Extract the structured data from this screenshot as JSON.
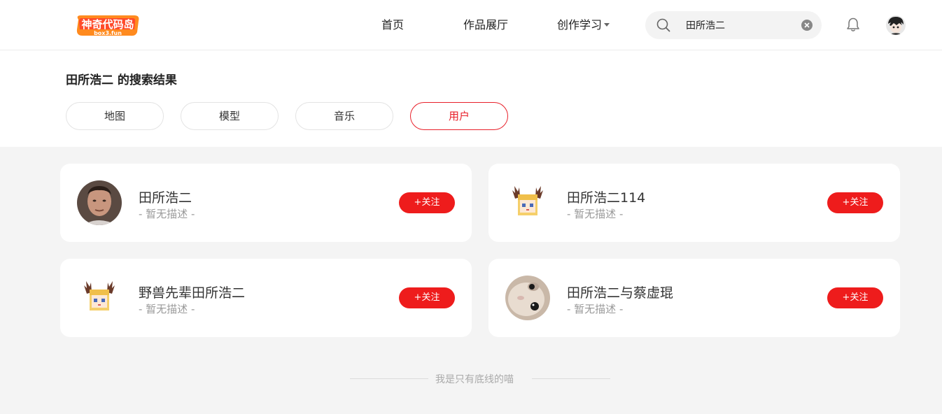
{
  "header": {
    "logo_text": "神奇代码岛",
    "logo_sub": "box3.fun",
    "nav": {
      "home": "首页",
      "gallery": "作品展厅",
      "learn": "创作学习"
    },
    "search": {
      "value": "田所浩二",
      "icon": "search-icon"
    },
    "colors": {
      "accent": "#ee1c1c"
    }
  },
  "results": {
    "title": "田所浩二 的搜索结果",
    "tabs": {
      "map": "地图",
      "model": "模型",
      "music": "音乐",
      "user": "用户"
    },
    "active_tab": "用户"
  },
  "users": [
    {
      "name": "田所浩二",
      "desc": "- 暂无描述 -",
      "follow": "+关注",
      "avatar": "photo-man"
    },
    {
      "name": "田所浩二114",
      "desc": "- 暂无描述 -",
      "follow": "+关注",
      "avatar": "antler-girl-pixel"
    },
    {
      "name": "野兽先辈田所浩二",
      "desc": "- 暂无描述 -",
      "follow": "+关注",
      "avatar": "antler-girl-pixel"
    },
    {
      "name": "田所浩二与蔡虚琨",
      "desc": "- 暂无描述 -",
      "follow": "+关注",
      "avatar": "cat-photo"
    }
  ],
  "footer": {
    "text": "我是只有底线的喵"
  }
}
